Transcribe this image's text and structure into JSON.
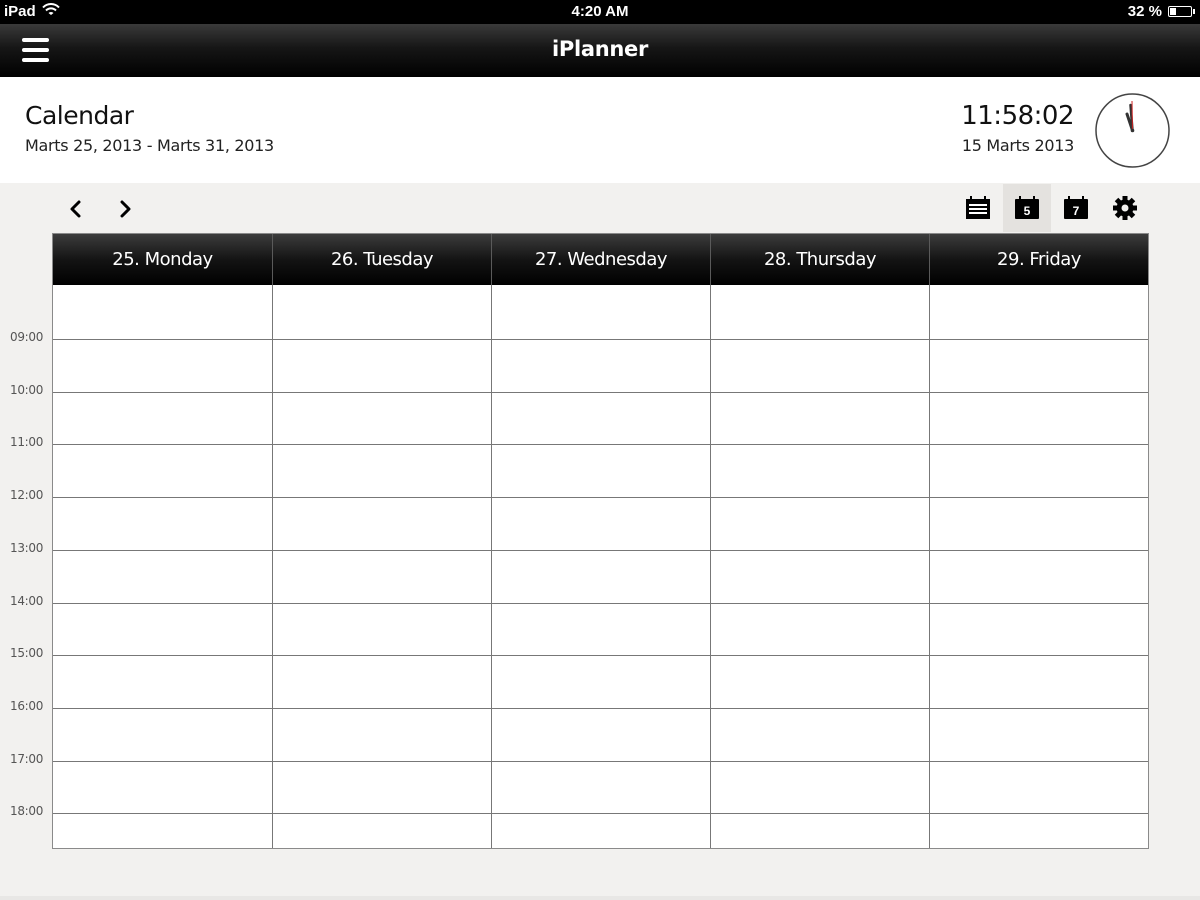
{
  "status_bar": {
    "device": "iPad",
    "time": "4:20 AM",
    "battery_text": "32 %",
    "battery_level": 0.32
  },
  "nav_bar": {
    "title": "iPlanner"
  },
  "header": {
    "title": "Calendar",
    "date_range": "Marts 25, 2013 - Marts 31, 2013",
    "clock_time": "11:58:02",
    "clock_date": "15 Marts 2013"
  },
  "toolbar": {
    "view_buttons": [
      {
        "name": "list-view",
        "icon": "list-calendar-icon"
      },
      {
        "name": "five-day-view",
        "icon": "calendar-5-icon",
        "label": "5",
        "active": true
      },
      {
        "name": "seven-day-view",
        "icon": "calendar-7-icon",
        "label": "7"
      },
      {
        "name": "settings",
        "icon": "gear-icon"
      }
    ]
  },
  "calendar": {
    "days": [
      "25. Monday",
      "26. Tuesday",
      "27. Wednesday",
      "28. Thursday",
      "29. Friday"
    ],
    "hours": [
      "09:00",
      "10:00",
      "11:00",
      "12:00",
      "13:00",
      "14:00",
      "15:00",
      "16:00",
      "17:00",
      "18:00"
    ]
  },
  "colors": {
    "nav_bar": "#000000",
    "background": "#f2f1ef",
    "grid_line": "#777777",
    "clock_second_hand": "#cc2222"
  }
}
